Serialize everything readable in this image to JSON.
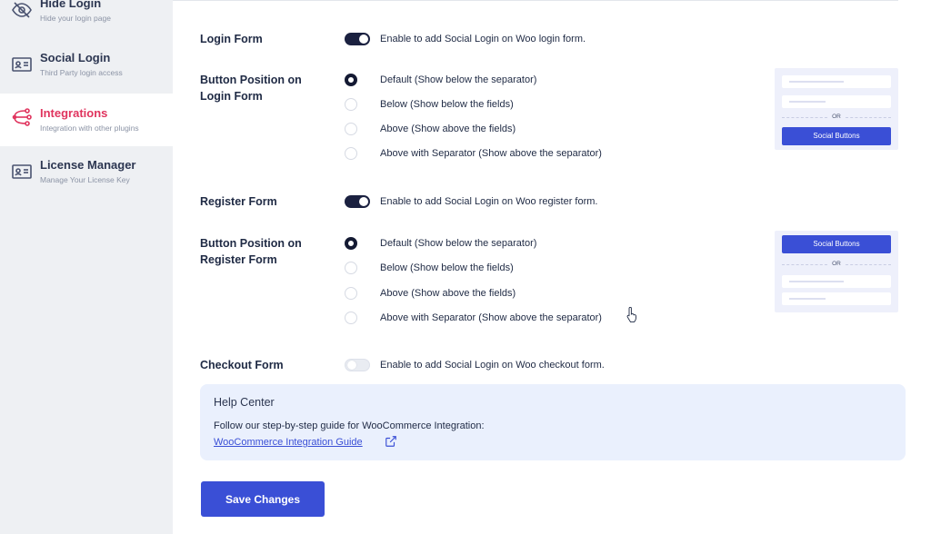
{
  "sidebar": {
    "items": [
      {
        "title": "Hide Login",
        "subtitle": "Hide your login page",
        "icon": "eye-slash-icon"
      },
      {
        "title": "Social Login",
        "subtitle": "Third Party login access",
        "icon": "id-card-icon"
      },
      {
        "title": "Integrations",
        "subtitle": "Integration with other plugins",
        "icon": "integrations-icon",
        "active": true
      },
      {
        "title": "License Manager",
        "subtitle": "Manage Your License Key",
        "icon": "license-card-icon"
      }
    ]
  },
  "login_form": {
    "label": "Login Form",
    "toggle_on": true,
    "toggle_text": "Enable to add Social Login on Woo login form."
  },
  "login_position": {
    "label": "Button Position on Login Form",
    "label_line1": "Button Position on",
    "label_line2": "Login Form",
    "options": [
      "Default (Show below the separator)",
      "Below (Show below the fields)",
      "Above (Show above the fields)",
      "Above with Separator (Show above the separator)"
    ],
    "selected_index": 0,
    "preview": {
      "or_text": "OR",
      "button_text": "Social Buttons"
    }
  },
  "register_form": {
    "label": "Register Form",
    "toggle_on": true,
    "toggle_text": "Enable to add Social Login on Woo register form."
  },
  "register_position": {
    "label_line1": "Button Position on",
    "label_line2": "Register Form",
    "options": [
      "Default (Show below the separator)",
      "Below (Show below the fields)",
      "Above (Show above the fields)",
      "Above with Separator (Show above the separator)"
    ],
    "selected_index": 0,
    "preview": {
      "or_text": "OR",
      "button_text": "Social Buttons"
    }
  },
  "checkout_form": {
    "label": "Checkout Form",
    "toggle_on": false,
    "toggle_text": "Enable to add Social Login on Woo checkout form."
  },
  "help_center": {
    "title": "Help Center",
    "text": "Follow our step-by-step guide for WooCommerce Integration:",
    "link": "WooCommerce Integration Guide"
  },
  "save_label": "Save Changes",
  "colors": {
    "accent": "#3a4fd6",
    "active_nav": "#e0345e",
    "toggle_on": "#1b2140"
  }
}
